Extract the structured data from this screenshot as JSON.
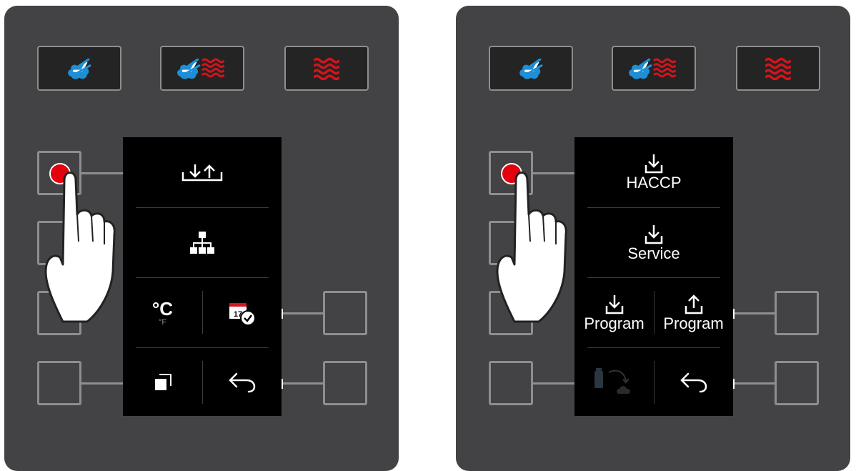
{
  "left_panel": {
    "mode_buttons": [
      {
        "icon": "steam-icon"
      },
      {
        "icon": "combi-steam-icon"
      },
      {
        "icon": "convection-heat-icon"
      }
    ],
    "menu": {
      "top_item_icon": "download-upload-icon",
      "second_item_icon": "network-icon",
      "unit_main": "°C",
      "unit_sub": "°F",
      "calendar_day": "17",
      "bottom_left_icon": "copy-icon",
      "bottom_right_icon": "back-arrow-icon"
    }
  },
  "right_panel": {
    "mode_buttons": [
      {
        "icon": "steam-icon"
      },
      {
        "icon": "combi-steam-icon"
      },
      {
        "icon": "convection-heat-icon"
      }
    ],
    "menu": {
      "haccp_label": "HACCP",
      "service_label": "Service",
      "program_download_label": "Program",
      "program_upload_label": "Program",
      "bottom_left_icon": "usb-transfer-icon",
      "bottom_right_icon": "back-arrow-icon"
    }
  },
  "colors": {
    "panel": "#434345",
    "key_border": "#8e8e8e",
    "steam_blue": "#1e8fd6",
    "heat_red": "#d4141c",
    "press_red": "#e3000f"
  }
}
